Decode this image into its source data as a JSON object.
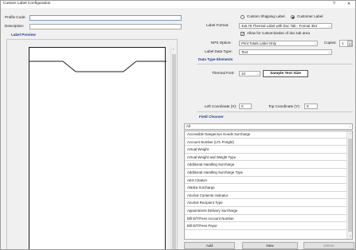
{
  "window": {
    "title": "Custom Label Configuration",
    "help": "?",
    "close": "✕"
  },
  "profile": {
    "code_label": "Profile Code:",
    "code_value": "",
    "description_label": "Description:",
    "description_value": ""
  },
  "label_preview": {
    "title": "Label Preview"
  },
  "label_type": {
    "option1": "Custom Shipping Label",
    "option2": "Customer Label",
    "selected": "Customer Label"
  },
  "label_format": {
    "label": "Label Format:",
    "value": "4x6.75 Thermal Label with Doc Tab - Format 354"
  },
  "allow_customization": {
    "label": "Allow for customization of doc tab area",
    "checked": true
  },
  "nps_option": {
    "label": "NPS Option:",
    "value": "Print Totals Label Only"
  },
  "copies": {
    "label": "Copies:",
    "value": "1"
  },
  "label_data_type": {
    "label": "Label Data Type:",
    "value": "Text"
  },
  "data_type_elements": {
    "title": "Data Type Elements",
    "thermal_font_label": "Thermal Font:",
    "thermal_font_value": "10",
    "sample_text": "Sample Text Size",
    "left_coord_label": "Left Coordinate (X):",
    "left_coord_value": "0",
    "top_coord_label": "Top Coordinate (Y):",
    "top_coord_value": "0"
  },
  "field_chooser": {
    "title": "Field Chooser",
    "filter_value": "All",
    "items": [
      "Accessible Dangerous Goods Surcharge",
      "Account Number (LTL Freight)",
      "Actual Weight",
      "Actual Weight and Weight Type",
      "Additional Handling Surcharge",
      "Additional Handling Surcharge Type",
      "AES Citation",
      "Alaska Surcharge",
      "Alcohol Contents Indicator",
      "Alcohol Recipient Type",
      "Appointment Delivery Surcharge",
      "Bill D/T/Fees Account Number",
      "Bill D/T/Fees Payor"
    ]
  },
  "buttons": {
    "add": "Add",
    "new": "New",
    "delete": "Delete"
  },
  "colors": {
    "accent": "#1f3f8f",
    "window_bg": "#f0f0f0",
    "input_border": "#7a9ec4"
  }
}
